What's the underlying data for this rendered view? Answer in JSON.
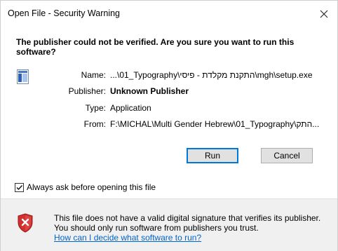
{
  "window": {
    "title": "Open File - Security Warning"
  },
  "headline": "The publisher could not be verified.  Are you sure you want to run this software?",
  "details": {
    "name_label": "Name:",
    "name_value": "...\\01_Typography\\התקנת מקלדת - פיסי\\mgh\\setup.exe",
    "publisher_label": "Publisher:",
    "publisher_value": "Unknown Publisher",
    "type_label": "Type:",
    "type_value": "Application",
    "from_label": "From:",
    "from_value": "F:\\MICHAL\\Multi Gender Hebrew\\01_Typography\\התק..."
  },
  "buttons": {
    "run": "Run",
    "cancel": "Cancel"
  },
  "checkbox": {
    "label": "Always ask before opening this file",
    "checked": true
  },
  "warning": {
    "text": "This file does not have a valid digital signature that verifies its publisher.  You should only run software from publishers you trust.",
    "link": "How can I decide what software to run?"
  },
  "colors": {
    "accent": "#0078d7",
    "link": "#0066cc",
    "shield_red": "#c62828"
  }
}
